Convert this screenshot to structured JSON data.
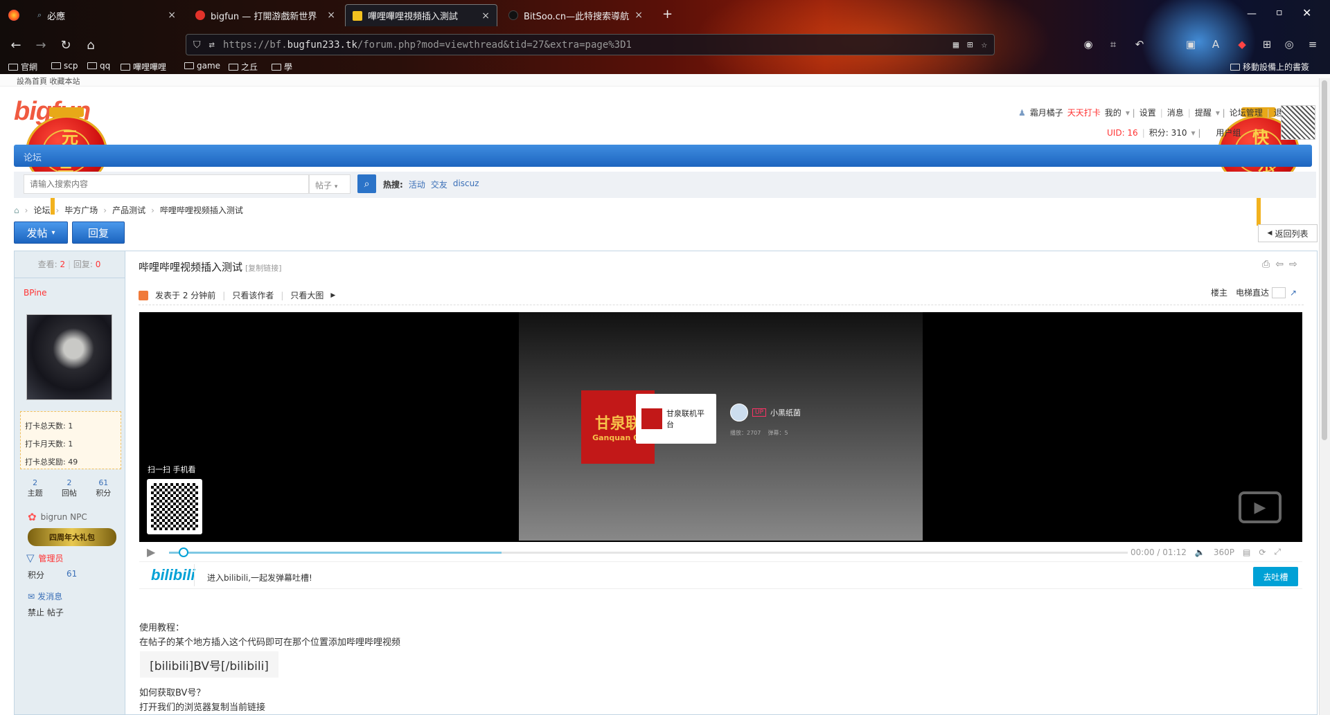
{
  "browser": {
    "tabs": [
      {
        "label": "必應"
      },
      {
        "label": "bigfun — 打開游戲新世界"
      },
      {
        "label": "嗶哩嗶哩視頻插入測試"
      },
      {
        "label": "BitSoo.cn—此特搜索導航"
      }
    ],
    "new_tab": "+",
    "url_prefix": "https://bf.",
    "url_host": "bugfun233.tk",
    "url_path": "/forum.php?mod=viewthread&tid=27&extra=page%3D1",
    "bookmarks": [
      "官網",
      "scp",
      "qq",
      "嗶哩嗶哩",
      "game",
      "之丘",
      "學"
    ],
    "mobile_bookmarks": "移動設備上的書簽"
  },
  "site": {
    "top_links": "設為首頁  收藏本站",
    "logo": "bigfun",
    "lantern_left": [
      "元",
      "旦"
    ],
    "lantern_right": [
      "快",
      "乐"
    ],
    "user": {
      "name": "霜月橘子",
      "checkin": "天天打卡",
      "links": [
        "我的",
        "设置",
        "消息",
        "提醒",
        "论坛管理",
        "退出"
      ],
      "uid": "UID: 16",
      "points": "积分: 310",
      "group": "用户组"
    },
    "nav": {
      "forum": "论坛"
    },
    "search": {
      "placeholder": "请输入搜索内容",
      "scope": "帖子",
      "hot_label": "热搜:",
      "hot": [
        "活动",
        "交友",
        "discuz"
      ]
    },
    "breadcrumb": [
      "论坛",
      "毕方广场",
      "产品测试",
      "哔哩哔哩视频插入测试"
    ],
    "buttons": {
      "post": "发帖",
      "reply": "回复",
      "back_list": "返回列表"
    }
  },
  "post": {
    "stats": {
      "views_label": "查看:",
      "views": "2",
      "replies_label": "回复:",
      "replies": "0"
    },
    "author": "BPine",
    "checkin": {
      "total_days": "打卡总天数:  1",
      "month_days": "打卡月天数:  1",
      "reward": "打卡总奖励:  49"
    },
    "user_stats": [
      {
        "value": "2",
        "label": "主题"
      },
      {
        "value": "2",
        "label": "回帖"
      },
      {
        "value": "61",
        "label": "积分"
      }
    ],
    "npc": "bigrun NPC",
    "medal": "四周年大礼包",
    "role": "管理员",
    "points_label": "积分",
    "points_value": "61",
    "send_msg": "发消息",
    "ban": "禁止 帖子",
    "title": "哔哩哔哩视频插入测试",
    "copy_link": "[复制链接]",
    "meta": {
      "posted": "发表于 2 分钟前",
      "only_author": "只看该作者",
      "big_img": "只看大图",
      "floor": "楼主",
      "elevator": "电梯直达"
    },
    "video": {
      "logo_text": "甘泉联",
      "logo_sub": "Ganquan Or",
      "card_title": "甘泉联机平台",
      "up_badge": "UP",
      "up_name": "小黑纸菌",
      "plays": "播放：2707",
      "danmaku": "弹幕：5",
      "qr_text": "扫一扫 手机看",
      "time": "00:00",
      "sep": "/",
      "duration": "01:12",
      "quality": "360P",
      "bili_logo": "bilibili",
      "bili_text": "进入bilibili,一起发弹幕吐槽!",
      "tucao": "去吐槽"
    },
    "body": {
      "tutorial": "使用教程：",
      "instruction": "在帖子的某个地方插入这个代码即可在那个位置添加哔哩哔哩视频",
      "code": "[bilibili]BV号[/bilibili]",
      "how_q": "如何获取BV号？",
      "how_a": "打开我们的浏览器复制当前链接"
    }
  },
  "colors": {
    "accent": "#1d65bf",
    "bili": "#00a1d6",
    "alert": "#ff3333"
  }
}
